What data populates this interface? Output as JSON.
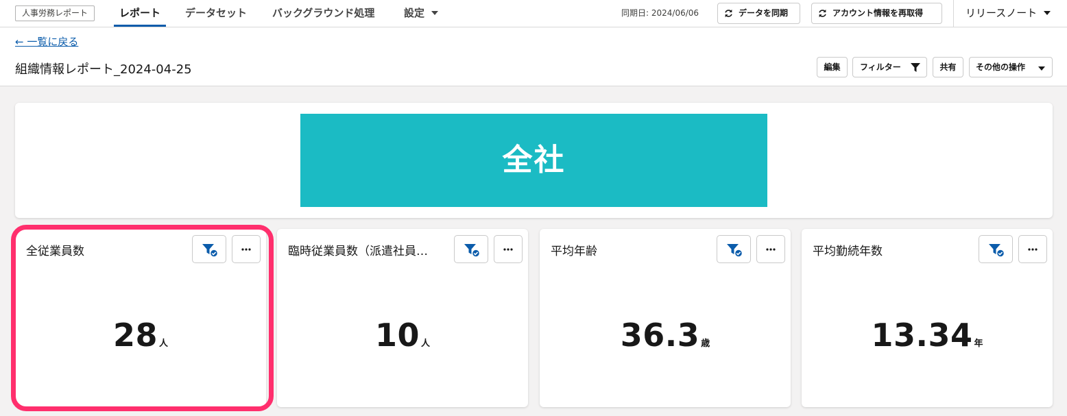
{
  "app": {
    "name": "人事労務レポート"
  },
  "nav": {
    "tabs": [
      {
        "label": "レポート",
        "active": true
      },
      {
        "label": "データセット",
        "active": false
      },
      {
        "label": "バックグラウンド処理",
        "active": false
      },
      {
        "label": "設定",
        "active": false
      }
    ],
    "sync_date": "同期日: 2024/06/06",
    "sync_button": "データを同期",
    "refetch_button": "アカウント情報を再取得",
    "release_notes": "リリースノート"
  },
  "report": {
    "back_link": "← 一覧に戻る",
    "title": "組織情報レポート_2024-04-25",
    "actions": {
      "edit": "編集",
      "filter": "フィルター",
      "share": "共有",
      "more": "その他の操作"
    }
  },
  "banner": {
    "text": "全社",
    "color": "#1bbbc4"
  },
  "cards": [
    {
      "title": "全従業員数",
      "value": "28",
      "unit": "人",
      "highlighted": true
    },
    {
      "title": "臨時従業員数（派遣社員…",
      "value": "10",
      "unit": "人"
    },
    {
      "title": "平均年齢",
      "value": "36.3",
      "unit": "歳"
    },
    {
      "title": "平均勤続年数",
      "value": "13.34",
      "unit": "年"
    }
  ],
  "colors": {
    "accent": "#0b5cab",
    "highlight": "#ff2f6d",
    "banner": "#1bbbc4"
  },
  "icons": {
    "filter_applied": "filter-check-icon",
    "more": "ellipsis-icon",
    "sync": "refresh-icon"
  }
}
